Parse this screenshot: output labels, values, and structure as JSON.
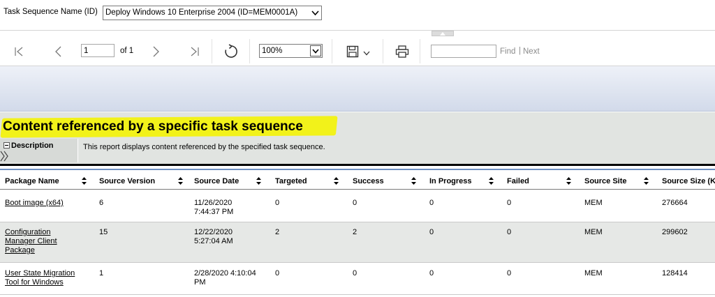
{
  "params": {
    "label": "Task Sequence Name (ID)",
    "selected": "Deploy Windows 10 Enterprise 2004 (ID=MEM0001A)"
  },
  "toolbar": {
    "page_value": "1",
    "page_of": "of 1",
    "zoom": "100%",
    "find_label": "Find",
    "find_separator": "|",
    "next_label": "Next"
  },
  "report": {
    "title": "Content referenced by a specific task sequence",
    "description_label": "Description",
    "description_text": "This report displays content referenced by the specified task sequence."
  },
  "table": {
    "headers": [
      "Package Name",
      "Source Version",
      "Source Date",
      "Targeted",
      "Success",
      "In Progress",
      "Failed",
      "Source Site",
      "Source Size (KB)"
    ],
    "rows": [
      {
        "package": "Boot image (x64)",
        "version": "6",
        "date": "11/26/2020\n7:44:37 PM",
        "targeted": "0",
        "success": "0",
        "in_progress": "0",
        "failed": "0",
        "site": "MEM",
        "size": "276664"
      },
      {
        "package": "Configuration\nManager Client\nPackage",
        "version": "15",
        "date": "12/22/2020\n5:27:04 AM",
        "targeted": "2",
        "success": "2",
        "in_progress": "0",
        "failed": "0",
        "site": "MEM",
        "size": "299602"
      },
      {
        "package": "User State Migration\nTool for Windows",
        "version": "1",
        "date": "2/28/2020 4:10:04\nPM",
        "targeted": "0",
        "success": "0",
        "in_progress": "0",
        "failed": "0",
        "site": "MEM",
        "size": "128414"
      }
    ]
  },
  "colors": {
    "highlight": "#f2f21a",
    "header_bg": "#e1e4e1",
    "alt_row": "#e6e8e6",
    "band_top": "#eef1f8",
    "band_bottom": "#d2daea"
  }
}
